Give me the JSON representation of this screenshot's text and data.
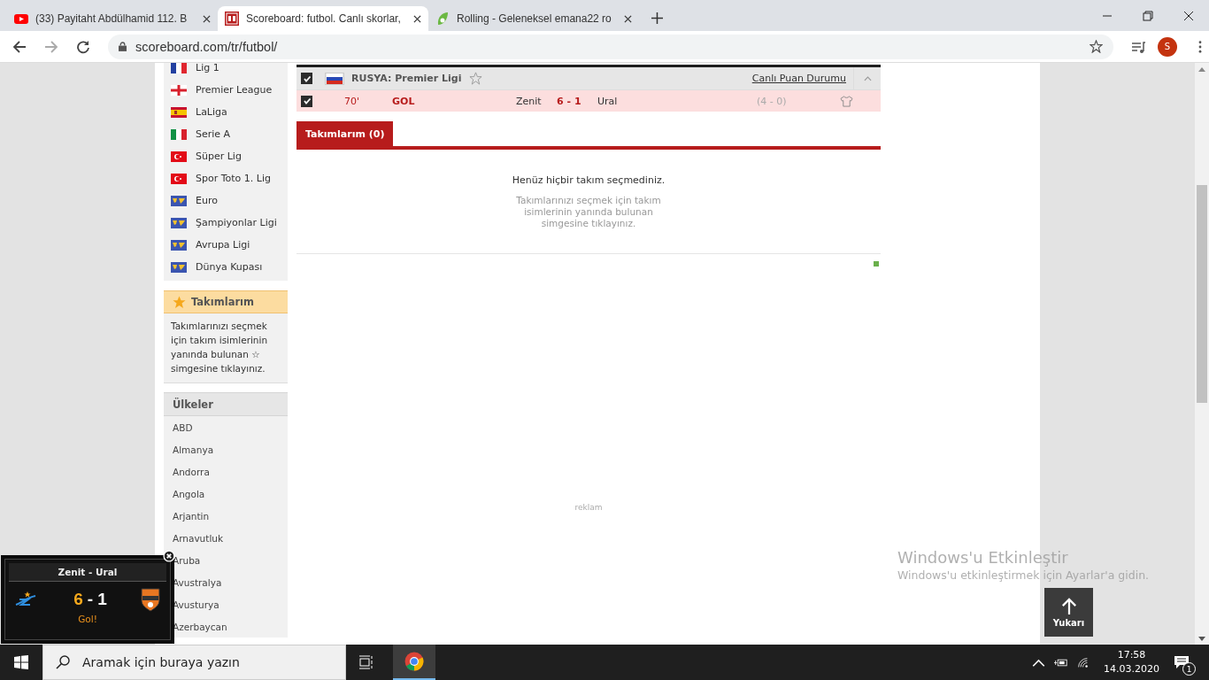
{
  "browser": {
    "tabs": [
      {
        "title": "(33) Payitaht Abdülhamid 112. B",
        "kind": "video",
        "selected": false
      },
      {
        "title": "Scoreboard: futbol. Canlı skorlar,",
        "kind": "sb",
        "selected": true
      },
      {
        "title": "Rolling - Geleneksel emana22 ro",
        "kind": "leaf",
        "selected": false
      }
    ],
    "url": "scoreboard.com/tr/futbol/",
    "avatar": "S"
  },
  "sidebar": {
    "leagues": [
      {
        "name": "Lig 1",
        "kind": "france"
      },
      {
        "name": "Premier League",
        "kind": "england"
      },
      {
        "name": "LaLiga",
        "kind": "spain"
      },
      {
        "name": "Serie A",
        "kind": "italy"
      },
      {
        "name": "Süper Lig",
        "kind": "turkey"
      },
      {
        "name": "Spor Toto 1. Lig",
        "kind": "turkey"
      },
      {
        "name": "Euro",
        "kind": "world"
      },
      {
        "name": "Şampiyonlar Ligi",
        "kind": "world"
      },
      {
        "name": "Avrupa Ligi",
        "kind": "world"
      },
      {
        "name": "Dünya Kupası",
        "kind": "world"
      }
    ],
    "my_teams": {
      "title": "Takımlarım",
      "text": "Takımlarınızı seçmek için takım isimlerinin yanında bulunan ☆ simgesine tıklayınız."
    },
    "countries_title": "Ülkeler",
    "countries": [
      "ABD",
      "Almanya",
      "Andorra",
      "Angola",
      "Arjantin",
      "Arnavutluk",
      "Aruba",
      "Avustralya",
      "Avusturya",
      "Azerbaycan"
    ]
  },
  "league": {
    "checked": true,
    "name": "RUSYA: Premier Ligi",
    "standings_link": "Canlı Puan Durumu"
  },
  "match": {
    "checked": true,
    "minute": "70'",
    "event": "GOL",
    "home": "Zenit",
    "score": "6 - 1",
    "away": "Ural",
    "halftime": "(4 - 0)"
  },
  "tabs": [
    {
      "label": "Takımlarım (0)",
      "selected": true
    }
  ],
  "empty": {
    "message": "Henüz hiçbir takım seçmediniz.",
    "hint": "Takımlarınızı seçmek için takım isimlerinin yanında bulunan simgesine tıklayınız."
  },
  "ad_label": "reklam",
  "popup": {
    "title": "Zenit - Ural",
    "home_score": "6",
    "separator": "-",
    "away_score": "1",
    "status": "Gol!"
  },
  "back_to_top": "Yukarı",
  "activation": {
    "title": "Windows'u Etkinleştir",
    "text": "Windows'u etkinleştirmek için Ayarlar'a gidin."
  },
  "taskbar": {
    "search_placeholder": "Aramak için buraya yazın",
    "time": "17:58",
    "date": "14.03.2020",
    "notifications": "1"
  }
}
